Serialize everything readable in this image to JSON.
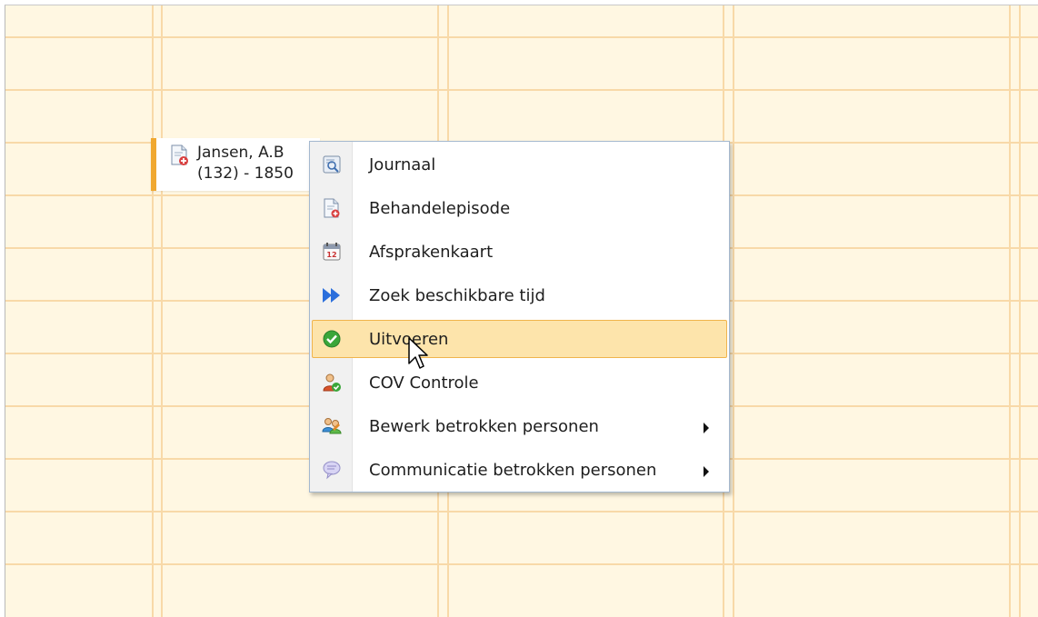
{
  "appointment": {
    "name": "Jansen, A.B",
    "details": "(132) - 1850"
  },
  "context_menu": {
    "items": [
      {
        "label": "Journaal",
        "icon": "journal-icon",
        "has_submenu": false
      },
      {
        "label": "Behandelepisode",
        "icon": "document-add-icon",
        "has_submenu": false
      },
      {
        "label": "Afsprakenkaart",
        "icon": "calendar-icon",
        "has_submenu": false
      },
      {
        "label": "Zoek beschikbare tijd",
        "icon": "fast-forward-icon",
        "has_submenu": false
      },
      {
        "label": "Uitvoeren",
        "icon": "check-circle-icon",
        "has_submenu": false,
        "highlighted": true
      },
      {
        "label": "COV Controle",
        "icon": "person-check-icon",
        "has_submenu": false
      },
      {
        "label": "Bewerk betrokken personen",
        "icon": "people-edit-icon",
        "has_submenu": true
      },
      {
        "label": "Communicatie betrokken personen",
        "icon": "speech-bubble-icon",
        "has_submenu": true
      }
    ]
  },
  "colors": {
    "grid_background": "#fff7e2",
    "grid_lines": "#f8d9a8",
    "appointment_accent": "#f0a830",
    "highlight_fill": "#fde4ab",
    "highlight_border": "#f0b44c",
    "menu_border": "#a4b8cf"
  }
}
